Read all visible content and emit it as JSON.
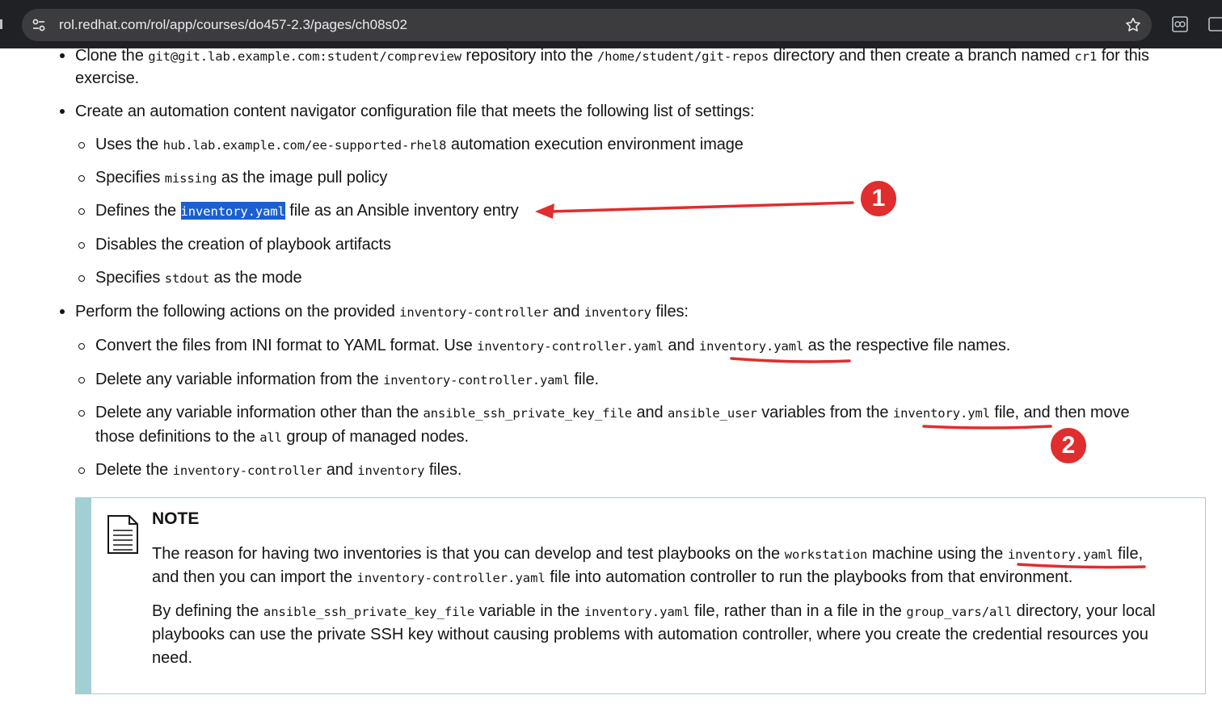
{
  "browser": {
    "url": "rol.redhat.com/rol/app/courses/do457-2.3/pages/ch08s02"
  },
  "items": {
    "i1": [
      "Clone the ",
      "git@git.lab.example.com:student/compreview",
      " repository into the ",
      "/home/student/git-repos",
      " directory and then create a branch named ",
      "cr1",
      " for this"
    ],
    "i1b": "exercise.",
    "i2": "Create an automation content navigator configuration file that meets the following list of settings:",
    "s1": [
      "Uses the ",
      "hub.lab.example.com/ee-supported-rhel8",
      " automation execution environment image"
    ],
    "s2": [
      "Specifies ",
      "missing",
      " as the image pull policy"
    ],
    "s3": [
      "Defines the ",
      "inventory.yaml",
      " file as an Ansible inventory entry"
    ],
    "s4": "Disables the creation of playbook artifacts",
    "s5": [
      "Specifies ",
      "stdout",
      " as the mode"
    ],
    "i3": [
      "Perform the following actions on the provided ",
      "inventory-controller",
      " and ",
      "inventory",
      " files:"
    ],
    "t1": [
      "Convert the files from INI format to YAML format. Use ",
      "inventory-controller.yaml",
      " and ",
      "inventory.yaml",
      " as the respective file names."
    ],
    "t2": [
      "Delete any variable information from the ",
      "inventory-controller.yaml",
      " file."
    ],
    "t3": [
      "Delete any variable information other than the ",
      "ansible_ssh_private_key_file",
      " and ",
      "ansible_user",
      " variables from the ",
      "inventory.yml",
      " file, and then move"
    ],
    "t3b": [
      "those definitions to the ",
      "all",
      " group of managed nodes."
    ],
    "t4": [
      "Delete the ",
      "inventory-controller",
      " and ",
      "inventory",
      " files."
    ]
  },
  "note": {
    "title": "NOTE",
    "p1a": [
      "The reason for having two inventories is that you can develop and test playbooks on the ",
      "workstation",
      " machine using the ",
      "inventory.yaml",
      " file,"
    ],
    "p1b": [
      "and then you can import the ",
      "inventory-controller.yaml",
      " file into automation controller to run the playbooks from that environment."
    ],
    "p2a": [
      "By defining the ",
      "ansible_ssh_private_key_file",
      " variable in the ",
      "inventory.yaml",
      " file, rather than in a file in the ",
      "group_vars/all",
      " directory, your local"
    ],
    "p2b": "playbooks can use the private SSH key without causing problems with automation controller, where you create the credential resources you",
    "p2c": "need."
  },
  "annotations": {
    "badge1": "1",
    "badge2": "2",
    "color": "#e02d2d"
  }
}
